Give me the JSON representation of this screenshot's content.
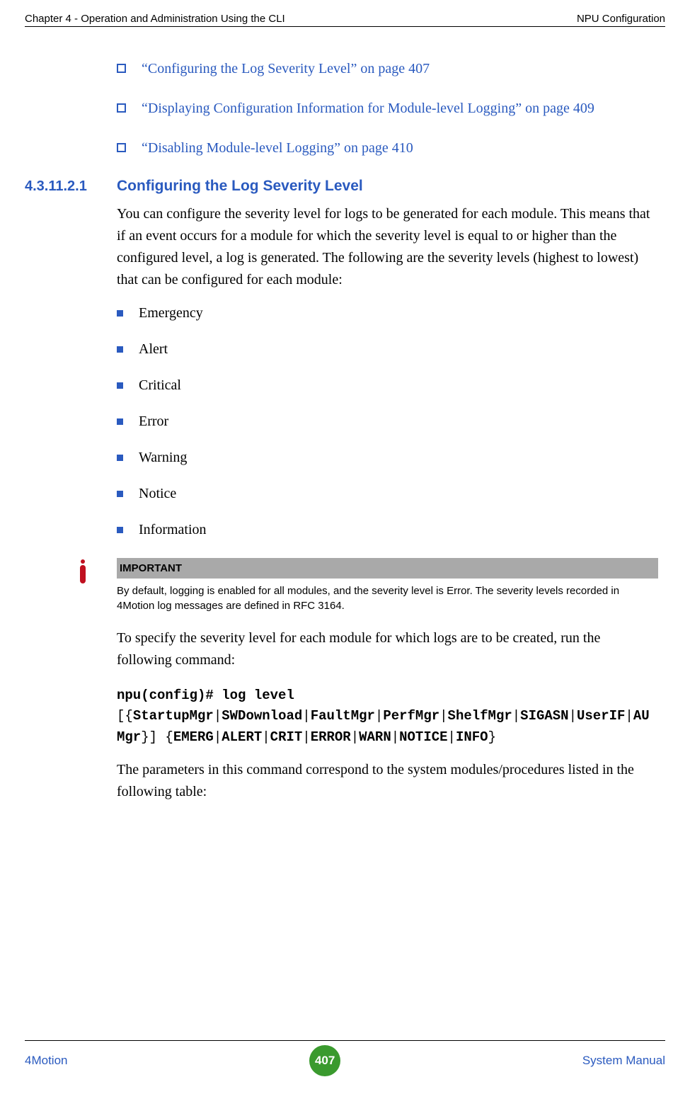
{
  "header": {
    "left": "Chapter 4 - Operation and Administration Using the CLI",
    "right": "NPU Configuration"
  },
  "xrefs": {
    "a": "“Configuring the Log Severity Level” on page 407",
    "b": "“Displaying Configuration Information for Module-level Logging” on page 409",
    "c": "“Disabling Module-level Logging” on page 410"
  },
  "section": {
    "number": "4.3.11.2.1",
    "title": "Configuring the Log Severity Level",
    "intro": "You can configure the severity level for logs to be generated for each module. This means that if an event occurs for a module for which the severity level is equal to or higher than the configured level, a log is generated. The following are the severity levels (highest to lowest) that can be configured for each module:",
    "levels": {
      "l0": "Emergency",
      "l1": "Alert",
      "l2": "Critical",
      "l3": "Error",
      "l4": "Warning",
      "l5": "Notice",
      "l6": "Information"
    }
  },
  "important": {
    "label": "IMPORTANT",
    "body": "By default, logging is enabled for all modules, and the severity level is Error. The severity levels recorded in 4Motion log messages are defined in RFC 3164."
  },
  "after_note": "To specify the severity level for each module for which logs are to be created, run the following command:",
  "cmd": {
    "p1": "npu(config)# log level",
    "p2a": "[{",
    "p2b": "StartupMgr",
    "p2c": "|",
    "p2d": "SWDownload",
    "p2e": "|",
    "p2f": "FaultMgr",
    "p2g": "|",
    "p2h": "PerfMgr",
    "p2i": "|",
    "p2j": "ShelfMgr",
    "p2k": "|",
    "p2l": "SIGASN",
    "p2m": "|",
    "p2n": "UserIF",
    "p2o": "|",
    "p2p": "AU",
    "p3a": "Mgr",
    "p3b": "}] {",
    "p3c": "EMERG",
    "p3d": "|",
    "p3e": "ALERT",
    "p3f": "|",
    "p3g": "CRIT",
    "p3h": "|",
    "p3i": "ERROR",
    "p3j": "|",
    "p3k": "WARN",
    "p3l": "|",
    "p3m": "NOTICE",
    "p3n": "|",
    "p3o": "INFO",
    "p3p": "}"
  },
  "closing": "The parameters in this command correspond to the system modules/procedures listed in the following table:",
  "footer": {
    "left": "4Motion",
    "page": "407",
    "right": "System Manual"
  }
}
